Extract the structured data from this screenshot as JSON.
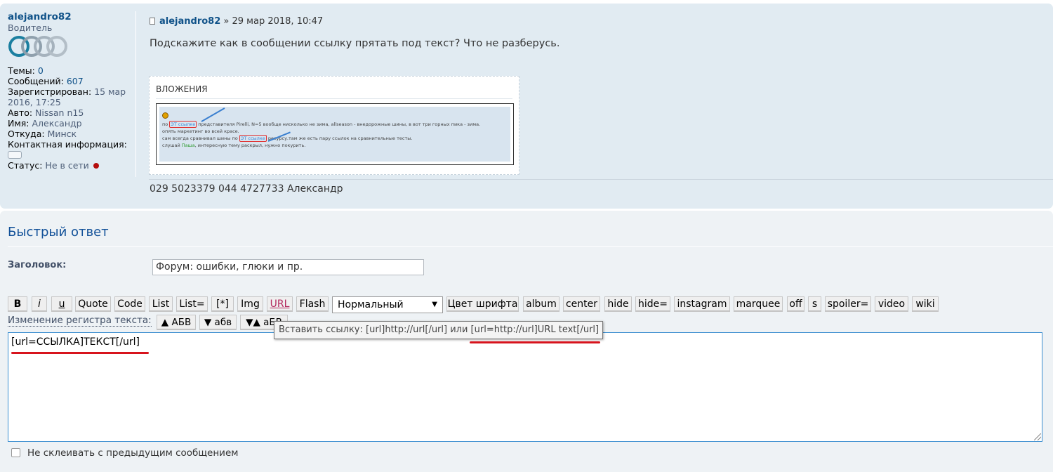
{
  "profile": {
    "username": "alejandro82",
    "rank": "Водитель",
    "rank_image": "four-rings-logo",
    "topics_label": "Темы:",
    "topics_value": "0",
    "posts_label": "Сообщений:",
    "posts_value": "607",
    "registered_label": "Зарегистрирован:",
    "registered_value": "15 мар 2016, 17:25",
    "car_label": "Авто:",
    "car_value": "Nissan n15",
    "name_label": "Имя:",
    "name_value": "Александр",
    "from_label": "Откуда:",
    "from_value": "Минск",
    "contact_label": "Контактная информация:",
    "contact_icon": "speech-bubble-icon",
    "status_label": "Статус:",
    "status_value": "Не в сети",
    "status_color": "#b40d0d"
  },
  "post": {
    "author": "alejandro82",
    "date": "» 29 мар 2018, 10:47",
    "icon": "document-icon",
    "content": "Подскажите как в сообщении ссылку прятать под текст? Что не разберусь.",
    "attachments_title": "ВЛОЖЕНИЯ",
    "attachment_lines": {
      "line1_a": "по ",
      "line1_link": "ЭТ ссылке",
      "line1_b": " представителя Pirelli, N=5 вообще нисколько не зима, allseason - внедорожные шины, в вот три горных пика - зима.",
      "line2": "опять маркетинг во всей красе.",
      "line3_a": "сам всегда сравнивал шины по ",
      "line3_link": "ЭТ ссылке",
      "line3_b": " ресурсу.там же есть пару ссылок на сравнительные тесты.",
      "line4_a": "слушай ",
      "line4_name": "Паша",
      "line4_b": ", интересную тему раскрыл, нужно покурить."
    },
    "signature": "029 5023379 044 4727733 Александр"
  },
  "quick_reply": {
    "title": "Быстрый ответ",
    "subject_label": "Заголовок:",
    "subject_value": "Форум: ошибки, глюки и пр.",
    "toolbar": {
      "b": "B",
      "i": "i",
      "u": "u",
      "quote": "Quote",
      "code": "Code",
      "list": "List",
      "list_eq": "List=",
      "star": "[*]",
      "img": "Img",
      "url": "URL",
      "flash": "Flash",
      "font_size": "Нормальный",
      "font_color": "Цвет шрифта",
      "album": "album",
      "center": "center",
      "hide": "hide",
      "hide_eq": "hide=",
      "instagram": "instagram",
      "marquee": "marquee",
      "off": "off",
      "s": "s",
      "spoiler_eq": "spoiler=",
      "video": "video",
      "wiki": "wiki"
    },
    "case_label": "Изменение регистра текста:",
    "case_upper": "▲ АБВ",
    "case_lower": "▼ абв",
    "case_toggle": "▼▲ аБВ",
    "tooltip": "Вставить ссылку: [url]http://url[/url] или [url=http://url]URL text[/url]",
    "message_text": "[url=ССЫЛКА]ТЕКСТ[/url]",
    "no_merge_label": "Не склеивать с предыдущим сообщением",
    "annotation_color": "#d7141d"
  }
}
